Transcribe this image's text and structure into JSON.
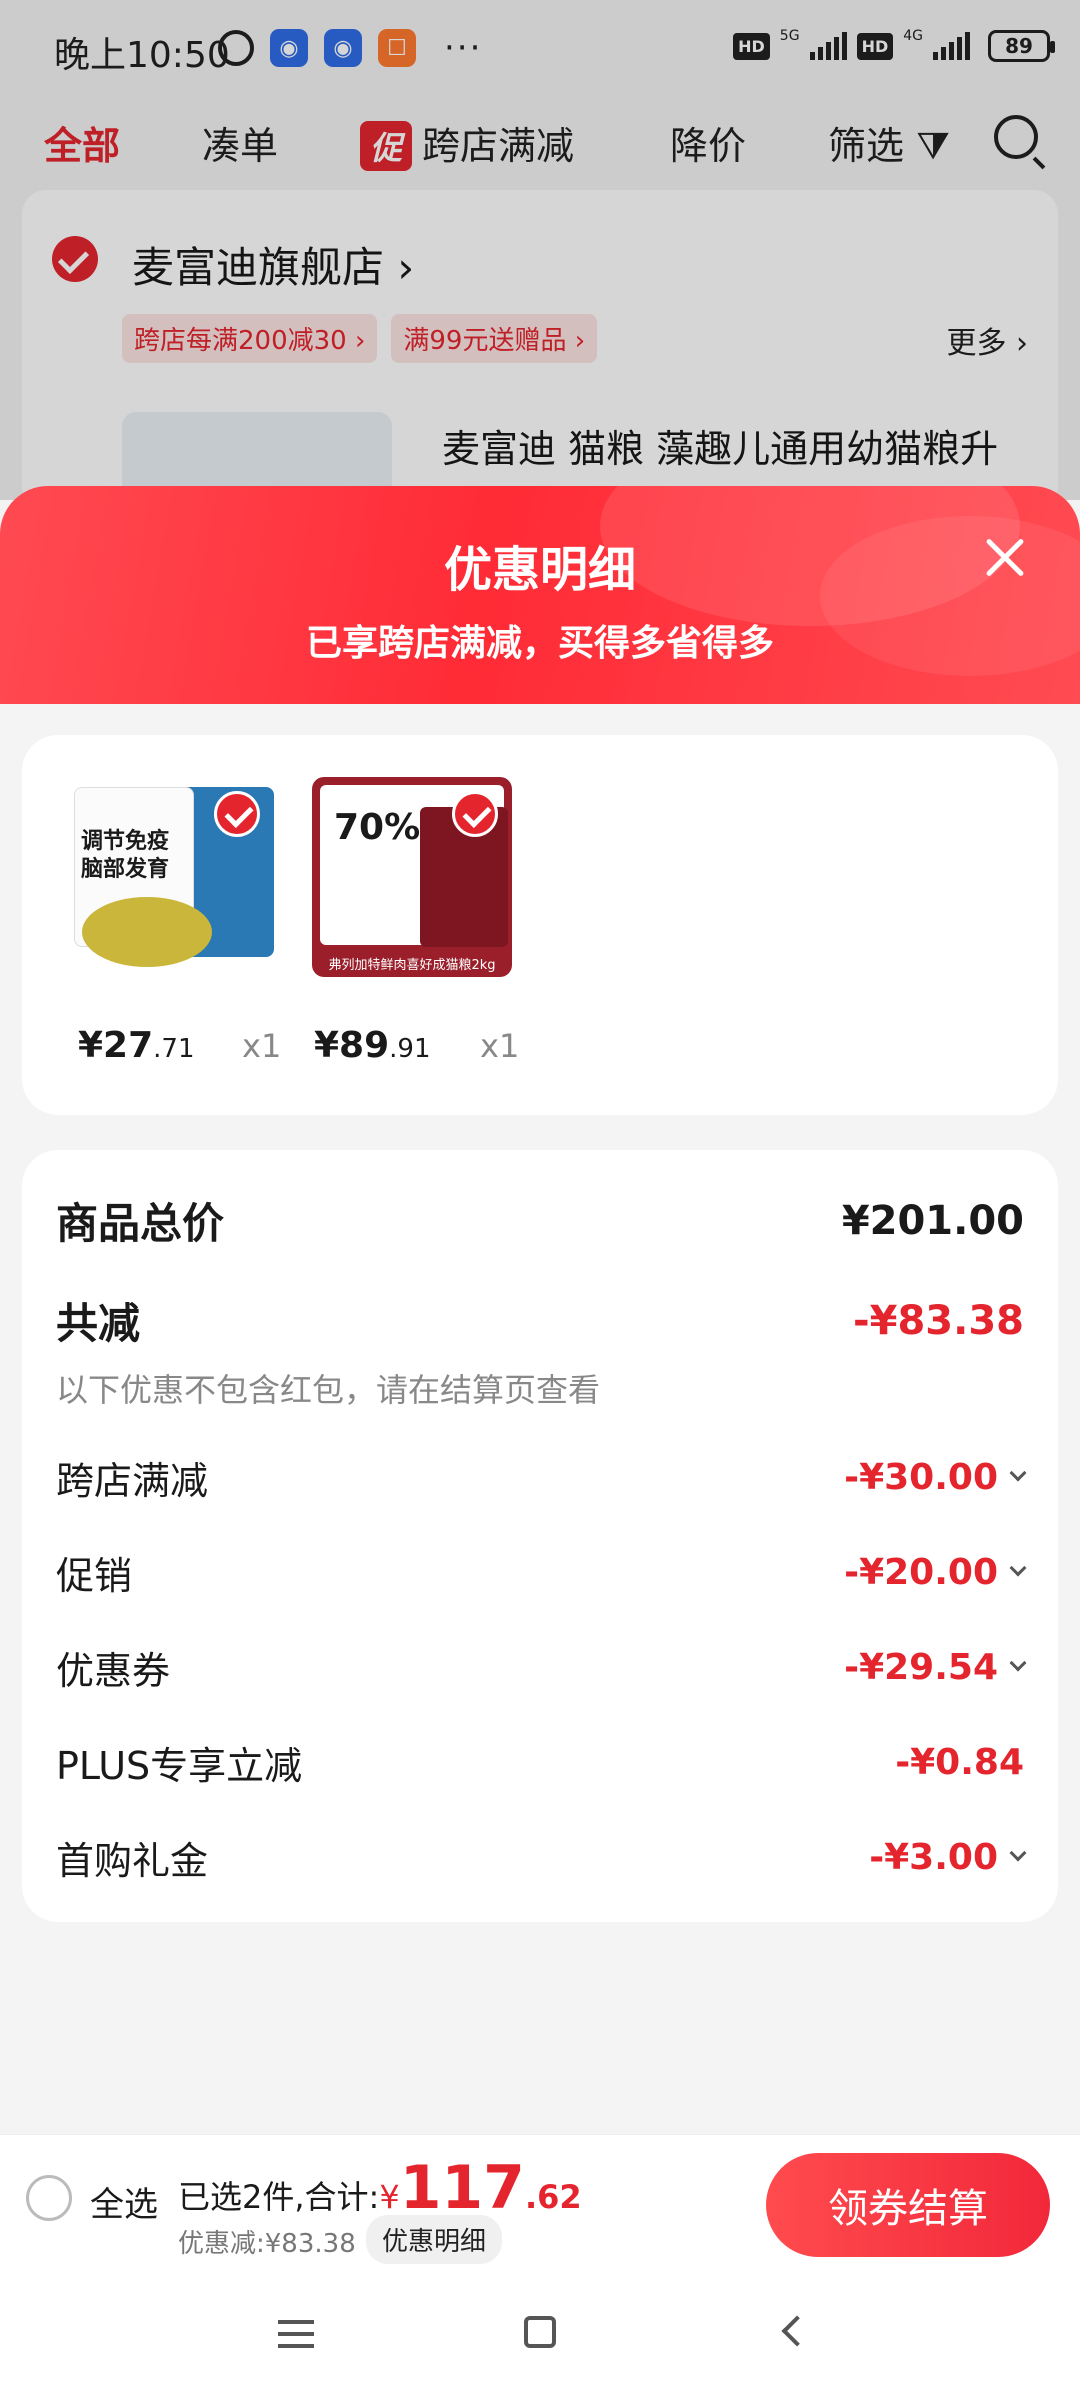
{
  "status_bar": {
    "time": "晚上10:50",
    "net1": "5G",
    "net2": "4G",
    "hd": "HD",
    "battery": "89",
    "dots": "···"
  },
  "top_nav": {
    "tabs": [
      "全部",
      "凑单",
      "跨店满减",
      "降价",
      "筛选"
    ],
    "promo_badge": "促"
  },
  "store": {
    "name": "麦富迪旗舰店 ›",
    "tags": [
      "跨店每满200减30 ›",
      "满99元送赠品 ›"
    ],
    "more": "更多 ›",
    "product_title": "麦富迪 猫粮 藻趣儿通用幼猫粮升"
  },
  "sheet": {
    "title": "优惠明细",
    "subtitle": "已享跨店满减，买得多省得多"
  },
  "products": [
    {
      "price_int": "¥27",
      "price_dec": ".71",
      "qty": "x1",
      "image_text": "调节免疫\n脑部发育"
    },
    {
      "price_int": "¥89",
      "price_dec": ".91",
      "qty": "x1",
      "image_text": "70%",
      "image_caption": "弗列加特鲜肉喜好成猫粮2kg"
    }
  ],
  "summary": {
    "total_label": "商品总价",
    "total_value": "¥201.00",
    "discount_label": "共减",
    "discount_value": "-¥83.38",
    "note": "以下优惠不包含红包，请在结算页查看",
    "items": [
      {
        "label": "跨店满减",
        "value": "-¥30.00"
      },
      {
        "label": "促销",
        "value": "-¥20.00"
      },
      {
        "label": "优惠券",
        "value": "-¥29.54"
      },
      {
        "label": "PLUS专享立减",
        "value": "-¥0.84"
      },
      {
        "label": "首购礼金",
        "value": "-¥3.00"
      }
    ]
  },
  "bottom_bar": {
    "select_all": "全选",
    "selected_text": "已选2件,合计:",
    "currency": "¥",
    "total_int": "117",
    "total_dec": ".62",
    "discount_text": "优惠减:¥83.38",
    "detail_pill": "优惠明细",
    "checkout": "领券结算"
  },
  "colors": {
    "accent": "#e4252e",
    "header_gradient": [
      "#ff4a52",
      "#ff2b36"
    ]
  }
}
